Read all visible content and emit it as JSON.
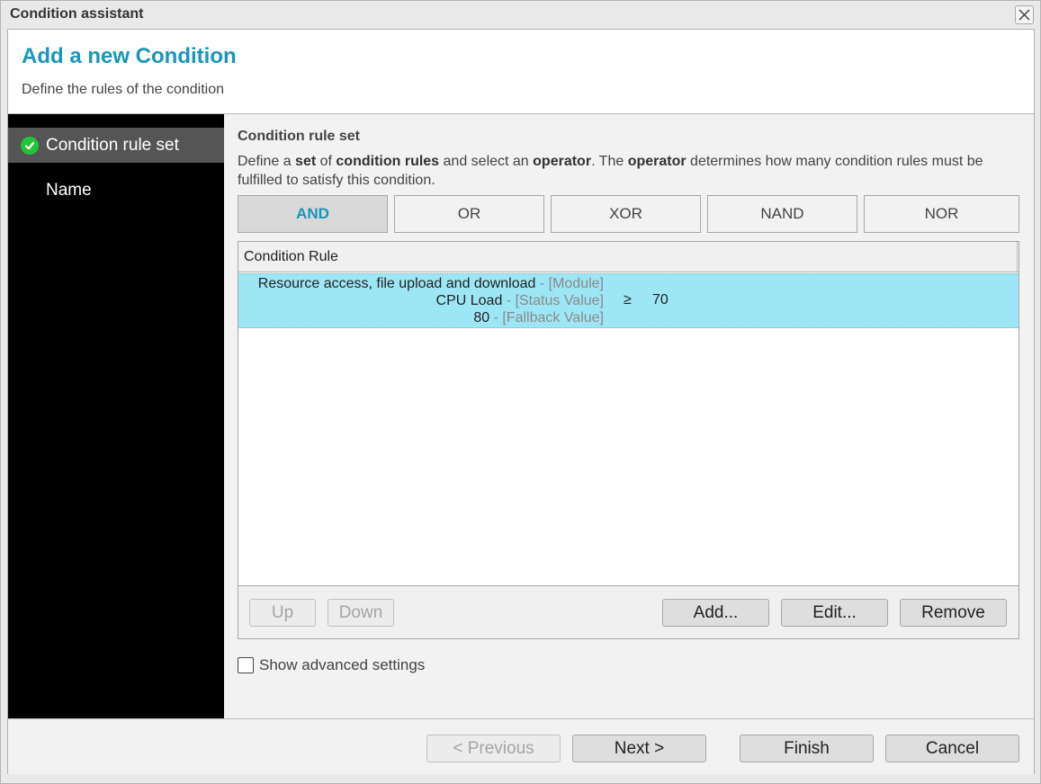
{
  "window": {
    "title": "Condition assistant",
    "close_icon": "close-x-icon"
  },
  "header": {
    "title": "Add a new Condition",
    "subtitle": "Define the rules of the condition"
  },
  "sidebar": {
    "items": [
      {
        "label": "Condition rule set",
        "active": true,
        "icon": "check-circle-icon"
      },
      {
        "label": "Name",
        "active": false
      }
    ],
    "accent": "#22c43a"
  },
  "content": {
    "title": "Condition rule set",
    "description": {
      "p1": "Define a ",
      "b1": "set",
      "p2": " of ",
      "b2": "condition rules",
      "p3": " and select an ",
      "b3": "operator",
      "p4": ". The ",
      "b4": "operator",
      "p5": " determines how many condition rules must be fulfilled to satisfy this condition."
    },
    "operators": [
      {
        "label": "AND",
        "selected": true
      },
      {
        "label": "OR",
        "selected": false
      },
      {
        "label": "XOR",
        "selected": false
      },
      {
        "label": "NAND",
        "selected": false
      },
      {
        "label": "NOR",
        "selected": false
      }
    ],
    "table": {
      "column_header": "Condition Rule",
      "rows": [
        {
          "module": "Resource access, file upload and download",
          "module_tag": " - [Module]",
          "status_value": "CPU Load",
          "status_tag": " - [Status Value]",
          "operator": "≥",
          "value": "70",
          "fallback": "80",
          "fallback_tag": " - [Fallback Value]",
          "selected": true
        }
      ]
    },
    "table_buttons": {
      "up": "Up",
      "down": "Down",
      "add": "Add...",
      "edit": "Edit...",
      "remove": "Remove"
    },
    "advanced_checkbox": {
      "label": "Show advanced settings",
      "checked": false
    }
  },
  "footer": {
    "previous": "< Previous",
    "next": "Next >",
    "finish": "Finish",
    "cancel": "Cancel"
  },
  "colors": {
    "accent": "#1a96b8",
    "selected_row": "#9de6f6",
    "sidebar_bg": "#000000",
    "sidebar_active": "#555555"
  }
}
